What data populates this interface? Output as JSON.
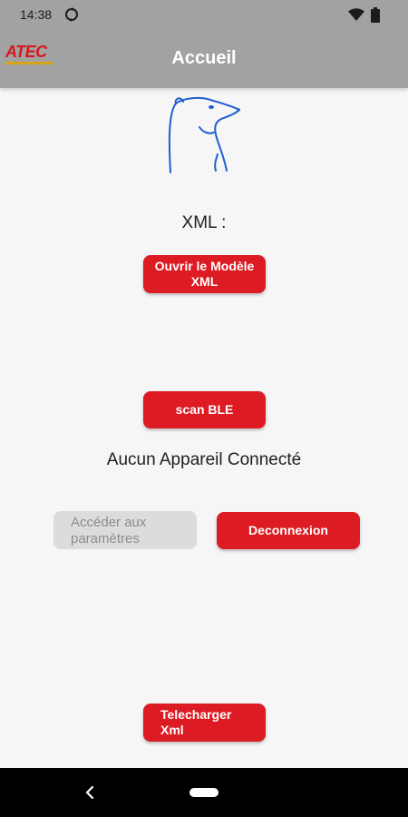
{
  "status_bar": {
    "time": "14:38",
    "icons": [
      "sync-icon",
      "wifi-icon",
      "battery-icon"
    ]
  },
  "app_bar": {
    "logo_text": "ATEC",
    "title": "Accueil",
    "colors": {
      "bar": "#a2a2a2",
      "logo": "#d8151a"
    }
  },
  "main": {
    "xml_label": "XML :",
    "open_button_label": "Ouvrir le Modèle XML",
    "scan_button_label": "scan BLE",
    "connection_status": "Aucun Appareil Connecté",
    "settings_button_label": "Accéder aux paramètres",
    "disconnect_button_label": "Deconnexion",
    "download_button_label": "Telecharger Xml",
    "accent_color": "#dd1b22"
  },
  "nav_bar": {
    "icons": [
      "back-icon",
      "home-pill"
    ]
  }
}
